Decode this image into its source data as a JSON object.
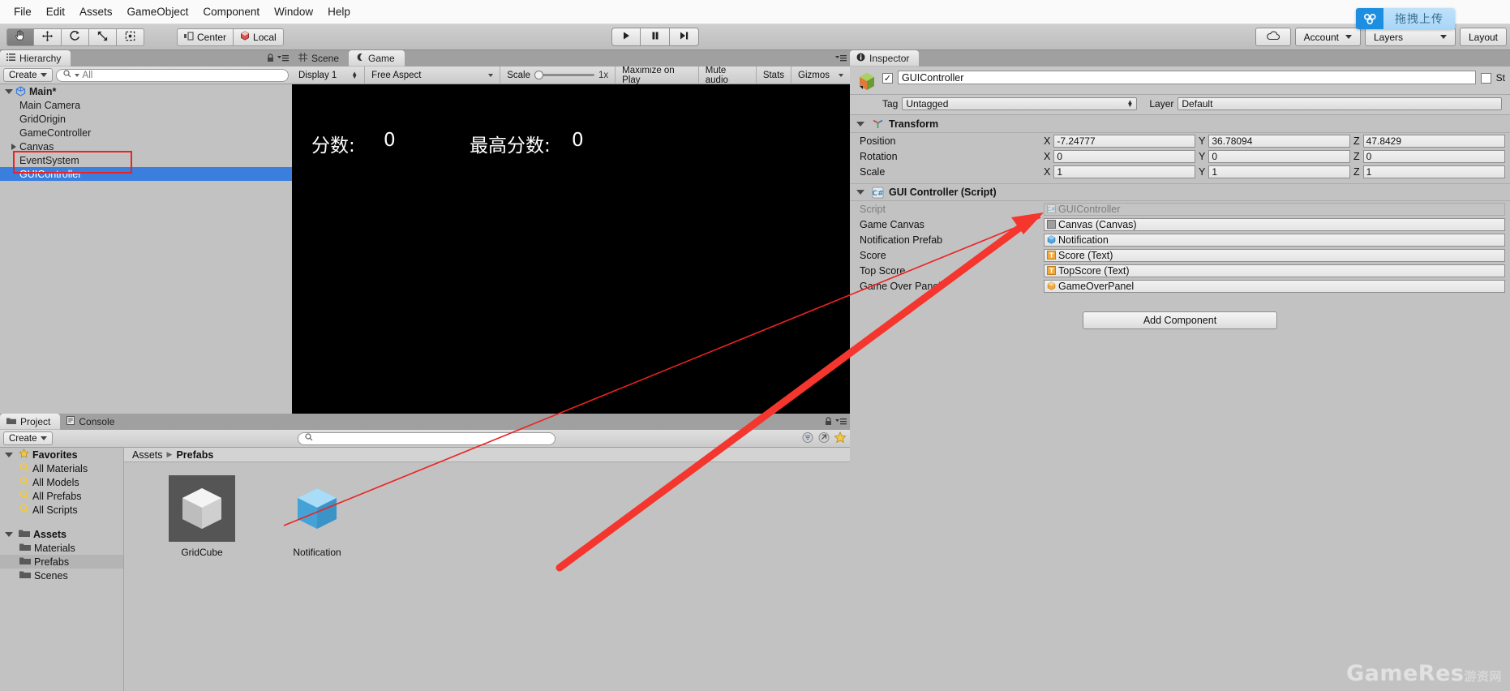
{
  "menubar": {
    "items": [
      "File",
      "Edit",
      "Assets",
      "GameObject",
      "Component",
      "Window",
      "Help"
    ]
  },
  "toolbar": {
    "tools": [
      "hand-tool",
      "move-tool",
      "rotate-tool",
      "scale-tool",
      "rect-tool"
    ],
    "pivot_label": "Center",
    "space_label": "Local",
    "play_label": "play-button",
    "pause_label": "pause-button",
    "step_label": "step-button",
    "cloud_label": "cloud-button",
    "account_label": "Account",
    "layers_label": "Layers",
    "layout_label": "Layout",
    "upload_badge": "拖拽上传"
  },
  "hierarchy": {
    "tab_label": "Hierarchy",
    "create_label": "Create",
    "search_placeholder": "All",
    "root": "Main*",
    "items": [
      {
        "label": "Main Camera",
        "expandable": false,
        "selected": false
      },
      {
        "label": "GridOrigin",
        "expandable": false,
        "selected": false
      },
      {
        "label": "GameController",
        "expandable": false,
        "selected": false
      },
      {
        "label": "Canvas",
        "expandable": true,
        "selected": false
      },
      {
        "label": "EventSystem",
        "expandable": false,
        "selected": false
      },
      {
        "label": "GUIController",
        "expandable": false,
        "selected": true
      }
    ]
  },
  "gameview": {
    "tabs": [
      {
        "label": "Scene",
        "active": false,
        "icon": "grid-icon"
      },
      {
        "label": "Game",
        "active": true,
        "icon": "gamepad-icon"
      }
    ],
    "display": "Display 1",
    "aspect": "Free Aspect",
    "scale_label": "Scale",
    "scale_value": "1x",
    "maximize_label": "Maximize on Play",
    "mute_label": "Mute audio",
    "stats_label": "Stats",
    "gizmos_label": "Gizmos",
    "score_label": "分数:",
    "score_value": "0",
    "topscore_label": "最高分数:",
    "topscore_value": "0"
  },
  "inspector": {
    "tab_label": "Inspector",
    "object_name": "GUIController",
    "object_enabled": true,
    "static_label": "St",
    "tag_label": "Tag",
    "tag_value": "Untagged",
    "layer_label": "Layer",
    "layer_value": "Default",
    "transform": {
      "title": "Transform",
      "rows": [
        {
          "label": "Position",
          "x": "-7.24777",
          "y": "36.78094",
          "z": "47.8429"
        },
        {
          "label": "Rotation",
          "x": "0",
          "y": "0",
          "z": "0"
        },
        {
          "label": "Scale",
          "x": "1",
          "y": "1",
          "z": "1"
        }
      ],
      "axes": [
        "X",
        "Y",
        "Z"
      ]
    },
    "script_component": {
      "title": "GUI Controller (Script)",
      "fields": [
        {
          "label": "Script",
          "value": "GUIController",
          "icon": "script-icon",
          "disabled": true
        },
        {
          "label": "Game Canvas",
          "value": "Canvas (Canvas)",
          "icon": "canvas-icon",
          "disabled": false
        },
        {
          "label": "Notification Prefab",
          "value": "Notification",
          "icon": "prefab-icon",
          "disabled": false
        },
        {
          "label": "Score",
          "value": "Score (Text)",
          "icon": "text-icon",
          "disabled": false
        },
        {
          "label": "Top Score",
          "value": "TopScore (Text)",
          "icon": "text-icon",
          "disabled": false
        },
        {
          "label": "Game Over Panel",
          "value": "GameOverPanel",
          "icon": "prefab-icon",
          "disabled": false
        }
      ]
    },
    "add_component_label": "Add Component"
  },
  "project": {
    "tabs": [
      {
        "label": "Project",
        "active": true,
        "icon": "folder-icon"
      },
      {
        "label": "Console",
        "active": false,
        "icon": "console-icon"
      }
    ],
    "create_label": "Create",
    "search_placeholder": "",
    "tree": [
      {
        "label": "Favorites",
        "icon": "star-icon",
        "bold": true,
        "indent": 0,
        "expanded": true,
        "selected": false
      },
      {
        "label": "All Materials",
        "icon": "search-icon",
        "bold": false,
        "indent": 1,
        "selected": false
      },
      {
        "label": "All Models",
        "icon": "search-icon",
        "bold": false,
        "indent": 1,
        "selected": false
      },
      {
        "label": "All Prefabs",
        "icon": "search-icon",
        "bold": false,
        "indent": 1,
        "selected": false
      },
      {
        "label": "All Scripts",
        "icon": "search-icon",
        "bold": false,
        "indent": 1,
        "selected": false
      },
      {
        "label": "Assets",
        "icon": "folder-icon",
        "bold": true,
        "indent": 0,
        "expanded": true,
        "selected": false
      },
      {
        "label": "Materials",
        "icon": "folder-icon",
        "bold": false,
        "indent": 1,
        "selected": false
      },
      {
        "label": "Prefabs",
        "icon": "folder-icon",
        "bold": false,
        "indent": 1,
        "selected": true
      },
      {
        "label": "Scenes",
        "icon": "folder-icon",
        "bold": false,
        "indent": 1,
        "selected": false
      }
    ],
    "breadcrumb": [
      "Assets",
      "Prefabs"
    ],
    "assets": [
      {
        "name": "GridCube",
        "kind": "cube-thumbnail"
      },
      {
        "name": "Notification",
        "kind": "prefab-thumbnail"
      }
    ]
  },
  "watermark": {
    "text": "GameRes",
    "suffix": "游资网"
  },
  "colors": {
    "selection_blue": "#3a7ede",
    "annotation_red": "#ee2222",
    "panel_gray": "#c2c2c2",
    "upload_blue": "#1e8fe0"
  }
}
